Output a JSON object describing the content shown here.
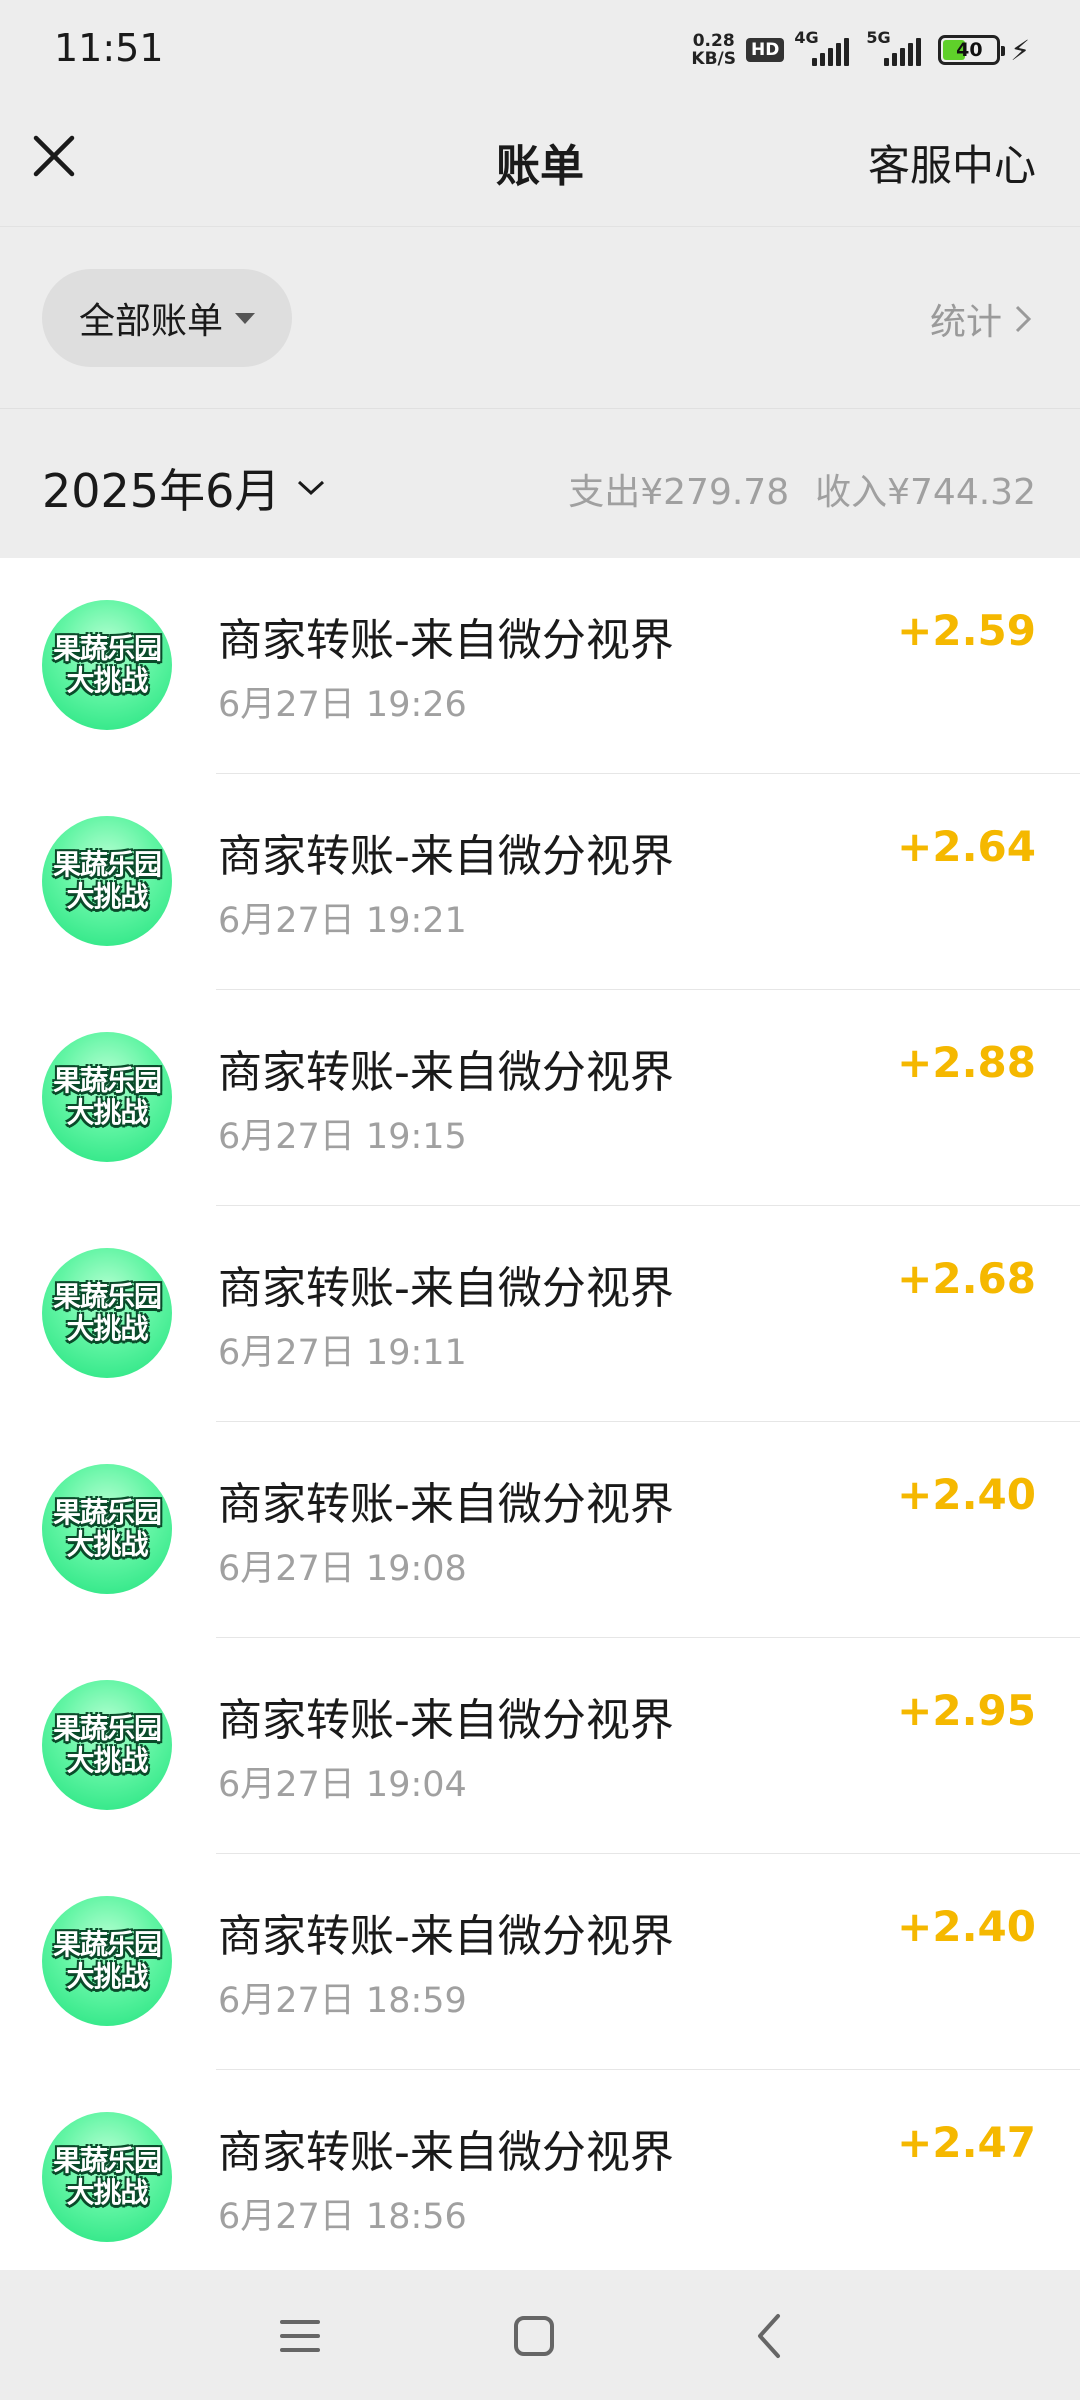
{
  "status_bar": {
    "time": "11:51",
    "net_speed_value": "0.28",
    "net_speed_unit": "KB/S",
    "hd_badge": "HD",
    "signal1_label": "4G",
    "signal2_label": "5G",
    "battery_level": "40"
  },
  "header": {
    "title": "账单",
    "service_label": "客服中心"
  },
  "filter": {
    "label": "全部账单",
    "stats_label": "统计"
  },
  "month": {
    "label": "2025年6月",
    "expense": "支出¥279.78",
    "income": "收入¥744.32"
  },
  "avatar_text": {
    "line1": "果蔬乐园",
    "line2": "大挑战"
  },
  "bills": [
    {
      "title": "商家转账-来自微分视界",
      "time": "6月27日 19:26",
      "amount": "+2.59"
    },
    {
      "title": "商家转账-来自微分视界",
      "time": "6月27日 19:21",
      "amount": "+2.64"
    },
    {
      "title": "商家转账-来自微分视界",
      "time": "6月27日 19:15",
      "amount": "+2.88"
    },
    {
      "title": "商家转账-来自微分视界",
      "time": "6月27日 19:11",
      "amount": "+2.68"
    },
    {
      "title": "商家转账-来自微分视界",
      "time": "6月27日 19:08",
      "amount": "+2.40"
    },
    {
      "title": "商家转账-来自微分视界",
      "time": "6月27日 19:04",
      "amount": "+2.95"
    },
    {
      "title": "商家转账-来自微分视界",
      "time": "6月27日 18:59",
      "amount": "+2.40"
    },
    {
      "title": "商家转账-来自微分视界",
      "time": "6月27日 18:56",
      "amount": "+2.47"
    }
  ],
  "colors": {
    "background": "#ededed",
    "income_amount": "#f5b800",
    "secondary_text": "#a0a0a0"
  },
  "icons": {
    "close": "close-icon",
    "filter_caret": "caret-down-icon",
    "stats_chevron": "chevron-right-icon",
    "month_chevron": "chevron-down-icon",
    "nav_menu": "menu-icon",
    "nav_home": "home-square-icon",
    "nav_back": "back-icon"
  }
}
